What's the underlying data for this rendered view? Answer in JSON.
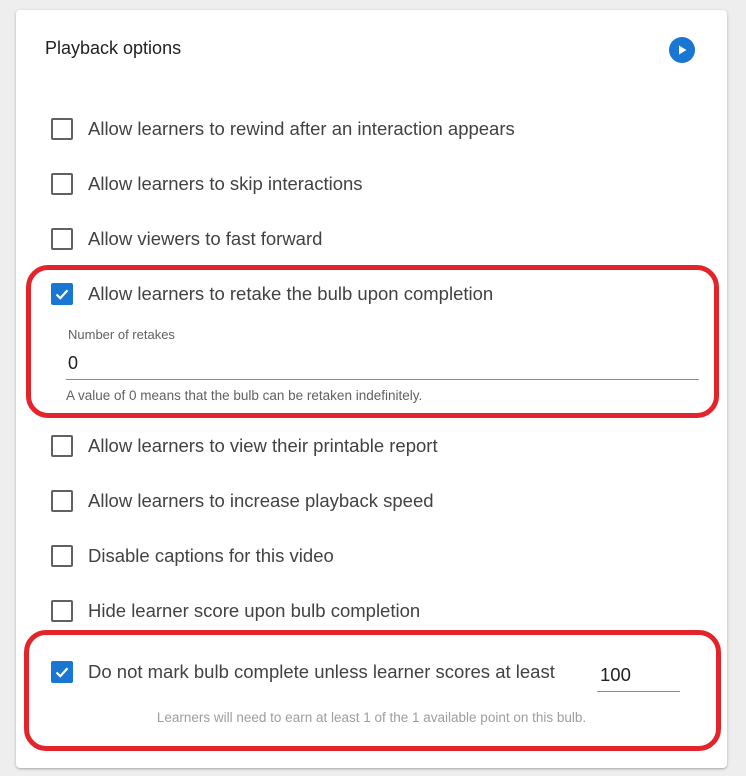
{
  "panel": {
    "title": "Playback options",
    "play_icon": "play-circle-icon",
    "accent_color": "#1976d2",
    "highlight_color": "#e3242b"
  },
  "options": [
    {
      "label": "Allow learners to rewind after an interaction appears",
      "checked": false
    },
    {
      "label": "Allow learners to skip interactions",
      "checked": false
    },
    {
      "label": "Allow viewers to fast forward",
      "checked": false
    },
    {
      "label": "Allow learners to retake the bulb upon completion",
      "checked": true
    },
    {
      "label": "Allow learners to view their printable report",
      "checked": false
    },
    {
      "label": "Allow learners to increase playback speed",
      "checked": false
    },
    {
      "label": "Disable captions for this video",
      "checked": false
    },
    {
      "label": "Hide learner score upon bulb completion",
      "checked": false
    },
    {
      "label": "Do not mark bulb complete unless learner scores at least",
      "checked": true
    }
  ],
  "retakes": {
    "label": "Number of retakes",
    "value": "0",
    "helper": "A value of 0 means that the bulb can be retaken indefinitely."
  },
  "min_score": {
    "value": "100",
    "helper": "Learners will need to earn at least 1 of the 1 available point on this bulb."
  }
}
